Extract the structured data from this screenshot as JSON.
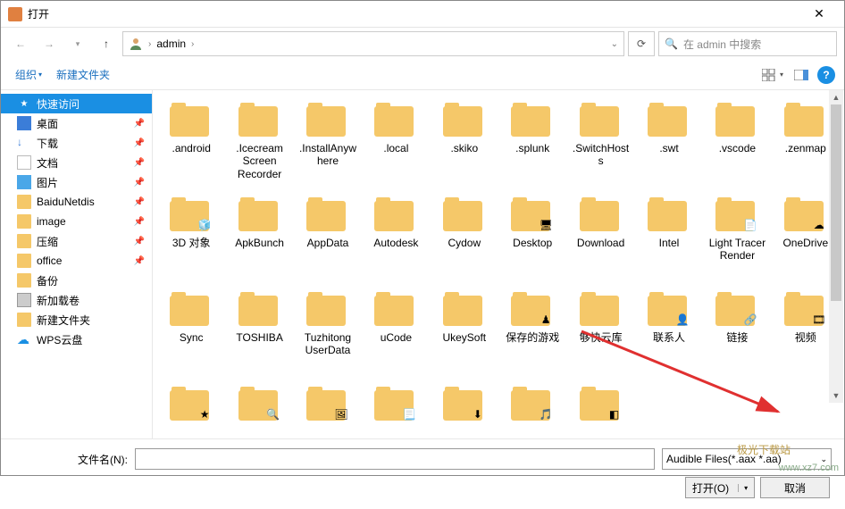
{
  "title": "打开",
  "breadcrumb": {
    "user": "admin"
  },
  "search_placeholder": "在 admin 中搜索",
  "toolbar": {
    "organize": "组织",
    "newfolder": "新建文件夹"
  },
  "sidebar": [
    {
      "label": "快速访问",
      "icon": "star",
      "selected": true
    },
    {
      "label": "桌面",
      "icon": "desk",
      "pin": true
    },
    {
      "label": "下载",
      "icon": "down",
      "pin": true
    },
    {
      "label": "文档",
      "icon": "doc",
      "pin": true
    },
    {
      "label": "图片",
      "icon": "pic",
      "pin": true
    },
    {
      "label": "BaiduNetdis",
      "icon": "folder",
      "pin": true
    },
    {
      "label": "image",
      "icon": "folder",
      "pin": true
    },
    {
      "label": "压缩",
      "icon": "folder",
      "pin": true
    },
    {
      "label": "office",
      "icon": "folder",
      "pin": true
    },
    {
      "label": "备份",
      "icon": "folder"
    },
    {
      "label": "新加载卷",
      "icon": "drive"
    },
    {
      "label": "新建文件夹",
      "icon": "folder"
    },
    {
      "label": "WPS云盘",
      "icon": "cloud"
    }
  ],
  "items": [
    {
      "name": ".android",
      "type": "folder"
    },
    {
      "name": ".Icecream Screen Recorder",
      "type": "folder"
    },
    {
      "name": ".InstallAnyw here",
      "type": "folder"
    },
    {
      "name": ".local",
      "type": "folder"
    },
    {
      "name": ".skiko",
      "type": "folder"
    },
    {
      "name": ".splunk",
      "type": "folder"
    },
    {
      "name": ".SwitchHost s",
      "type": "folder"
    },
    {
      "name": ".swt",
      "type": "folder"
    },
    {
      "name": ".vscode",
      "type": "folder"
    },
    {
      "name": ".zenmap",
      "type": "folder"
    },
    {
      "name": "3D 对象",
      "type": "folder",
      "overlay": "cube"
    },
    {
      "name": "ApkBunch",
      "type": "folder"
    },
    {
      "name": "AppData",
      "type": "folder"
    },
    {
      "name": "Autodesk",
      "type": "folder"
    },
    {
      "name": "Cydow",
      "type": "folder"
    },
    {
      "name": "Desktop",
      "type": "folder",
      "overlay": "desk"
    },
    {
      "name": "Download",
      "type": "folder"
    },
    {
      "name": "Intel",
      "type": "folder"
    },
    {
      "name": "Light Tracer Render",
      "type": "folder",
      "overlay": "doc"
    },
    {
      "name": "OneDrive",
      "type": "folder",
      "overlay": "cloud"
    },
    {
      "name": "Sync",
      "type": "folder"
    },
    {
      "name": "TOSHIBA",
      "type": "folder"
    },
    {
      "name": "Tuzhitong UserData",
      "type": "folder"
    },
    {
      "name": "uCode",
      "type": "folder"
    },
    {
      "name": "UkeySoft",
      "type": "folder"
    },
    {
      "name": "保存的游戏",
      "type": "folder",
      "overlay": "game"
    },
    {
      "name": "够快云库",
      "type": "folder"
    },
    {
      "name": "联系人",
      "type": "folder",
      "overlay": "contact"
    },
    {
      "name": "链接",
      "type": "folder",
      "overlay": "link"
    },
    {
      "name": "视频",
      "type": "folder",
      "overlay": "video"
    },
    {
      "name": "",
      "type": "folder",
      "overlay": "fav"
    },
    {
      "name": "",
      "type": "folder",
      "overlay": "search"
    },
    {
      "name": "",
      "type": "folder",
      "overlay": "pic"
    },
    {
      "name": "",
      "type": "folder",
      "overlay": "docs"
    },
    {
      "name": "",
      "type": "folder",
      "overlay": "down"
    },
    {
      "name": "",
      "type": "folder",
      "overlay": "music"
    },
    {
      "name": "",
      "type": "folder",
      "overlay": "purple"
    }
  ],
  "filename_label": "文件名(N):",
  "filetype": "Audible Files(*.aax *.aa)",
  "open_btn": "打开(O)",
  "cancel_btn": "取消",
  "watermark_site": "www.xz7.com",
  "watermark_label": "极光下载站"
}
